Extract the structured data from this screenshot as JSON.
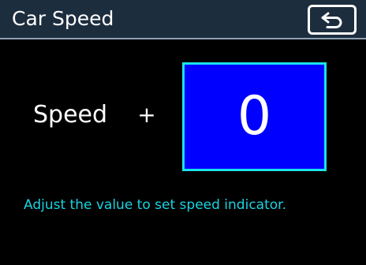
{
  "header": {
    "title": "Car Speed",
    "back_icon": "return-arrow-icon"
  },
  "control": {
    "label": "Speed",
    "increment_label": "+",
    "value": "0"
  },
  "hint": {
    "text": "Adjust the value to set speed indicator."
  },
  "colors": {
    "background": "#000000",
    "title_bar": "#1c2d3e",
    "title_border": "#8fa3b6",
    "value_box_fill": "#0000ff",
    "value_box_border": "#19e3e8",
    "hint_text": "#19d3e0",
    "text": "#ffffff"
  }
}
